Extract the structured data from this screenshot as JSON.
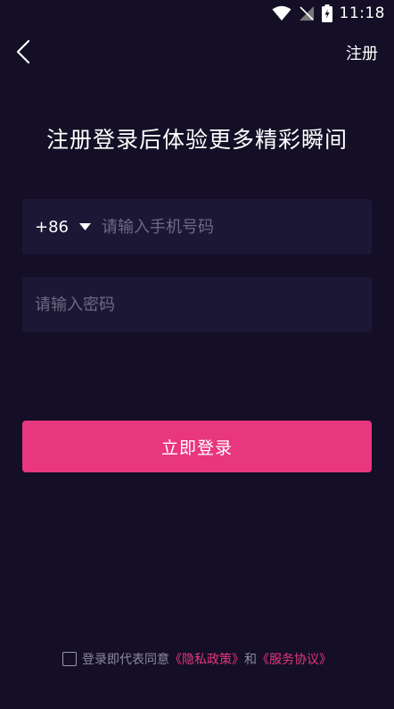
{
  "status_bar": {
    "time": "11:18"
  },
  "header": {
    "register_label": "注册"
  },
  "headline": "注册登录后体验更多精彩瞬间",
  "phone_field": {
    "country_code": "+86",
    "placeholder": "请输入手机号码"
  },
  "password_field": {
    "placeholder": "请输入密码"
  },
  "login_button": {
    "label": "立即登录"
  },
  "agreement": {
    "prefix": "登录即代表同意",
    "privacy_link": "《隐私政策》",
    "conjunction": "和",
    "service_link": "《服务协议》"
  },
  "colors": {
    "background": "#140f26",
    "field_bg": "#1c1735",
    "accent": "#e8367f"
  }
}
